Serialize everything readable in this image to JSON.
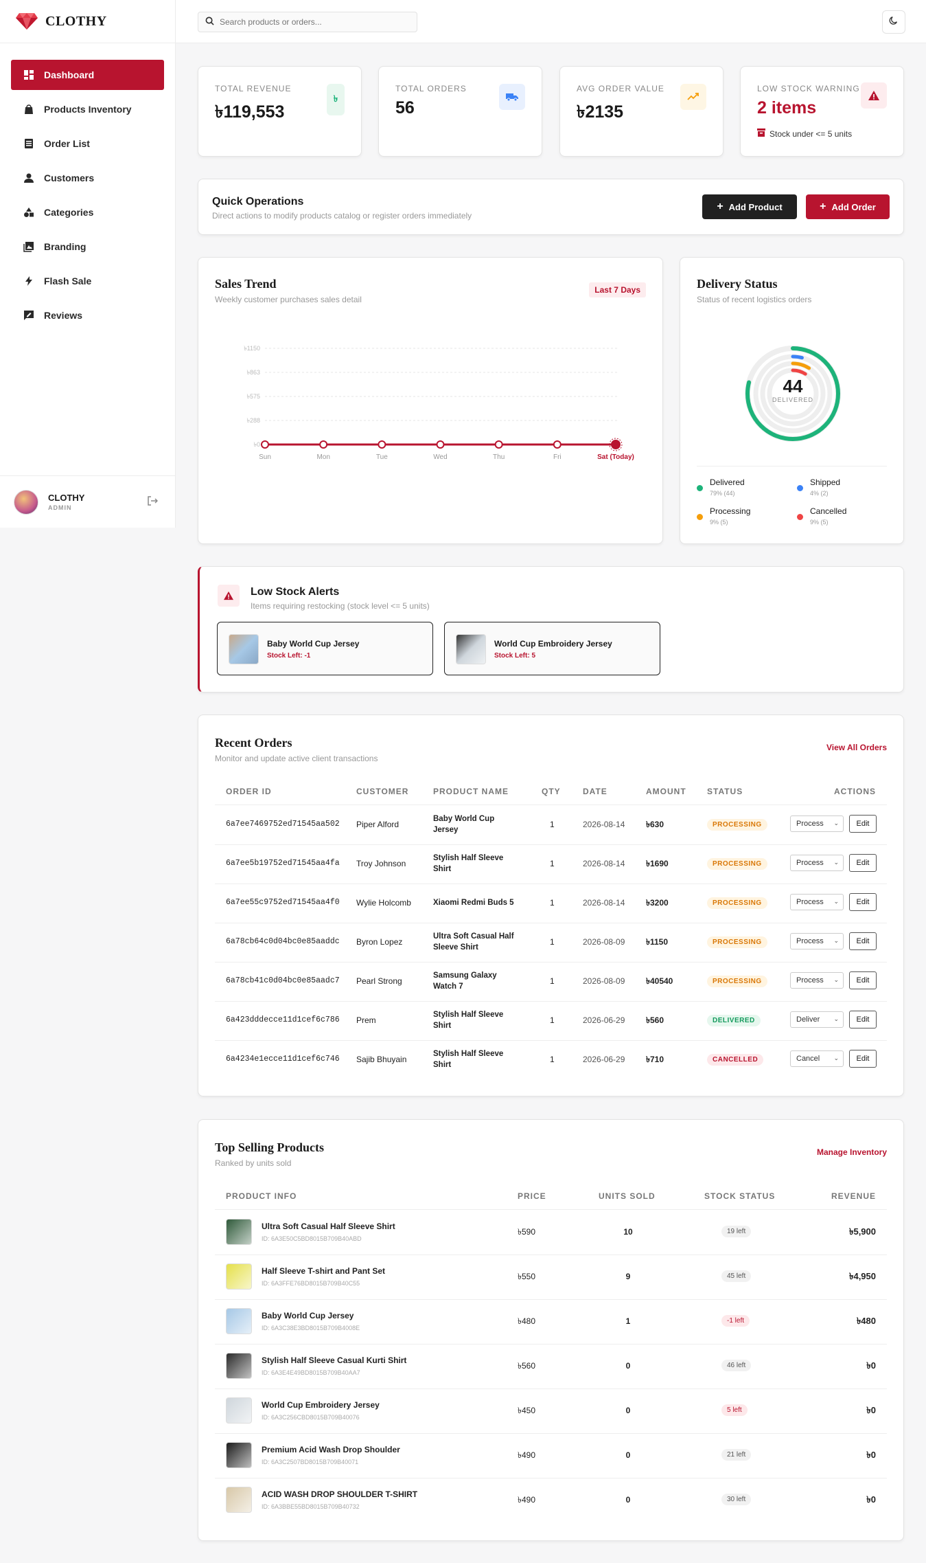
{
  "app": {
    "name": "CLOTHY"
  },
  "sidebar": {
    "items": [
      {
        "label": "Dashboard",
        "icon": "dashboard-icon"
      },
      {
        "label": "Products Inventory",
        "icon": "bag-icon"
      },
      {
        "label": "Order List",
        "icon": "list-icon"
      },
      {
        "label": "Customers",
        "icon": "person-icon"
      },
      {
        "label": "Categories",
        "icon": "categories-icon"
      },
      {
        "label": "Branding",
        "icon": "image-icon"
      },
      {
        "label": "Flash Sale",
        "icon": "bolt-icon"
      },
      {
        "label": "Reviews",
        "icon": "review-icon"
      }
    ],
    "user": {
      "name": "CLOTHY",
      "role": "ADMIN"
    }
  },
  "search": {
    "placeholder": "Search products or orders..."
  },
  "kpis": {
    "revenue": {
      "label": "TOTAL REVENUE",
      "value": "৳119,553",
      "icon": "৳"
    },
    "orders": {
      "label": "TOTAL ORDERS",
      "value": "56"
    },
    "aov": {
      "label": "AVG ORDER VALUE",
      "value": "৳2135"
    },
    "low_stock": {
      "label": "LOW STOCK WARNING",
      "value": "2 items",
      "note": "Stock under <= 5 units"
    }
  },
  "quick_ops": {
    "title": "Quick Operations",
    "subtitle": "Direct actions to modify products catalog or register orders immediately",
    "add_product": "Add Product",
    "add_order": "Add Order"
  },
  "sales_trend": {
    "title": "Sales Trend",
    "subtitle": "Weekly customer purchases sales detail",
    "range": "Last 7 Days"
  },
  "chart_data": {
    "type": "line",
    "categories": [
      "Sun",
      "Mon",
      "Tue",
      "Wed",
      "Thu",
      "Fri",
      "Sat (Today)"
    ],
    "values": [
      0,
      0,
      0,
      0,
      0,
      0,
      0
    ],
    "y_ticks": [
      "৳1150",
      "৳863",
      "৳575",
      "৳288",
      "৳0"
    ],
    "ylim": [
      0,
      1150
    ],
    "grid": true,
    "color": "#b8142f"
  },
  "delivery": {
    "title": "Delivery Status",
    "subtitle": "Status of recent logistics orders",
    "center_value": "44",
    "center_label": "DELIVERED",
    "legend": [
      {
        "name": "Delivered",
        "detail": "79% (44)",
        "color": "#1db37a",
        "fraction": 0.79
      },
      {
        "name": "Shipped",
        "detail": "4% (2)",
        "color": "#3b82f6",
        "fraction": 0.04
      },
      {
        "name": "Processing",
        "detail": "9% (5)",
        "color": "#f59e0b",
        "fraction": 0.09
      },
      {
        "name": "Cancelled",
        "detail": "9% (5)",
        "color": "#ef4444",
        "fraction": 0.09
      }
    ]
  },
  "low_stock": {
    "title": "Low Stock Alerts",
    "subtitle": "Items requiring restocking (stock level <= 5 units)",
    "items": [
      {
        "name": "Baby World Cup Jersey",
        "stock": "Stock Left: -1"
      },
      {
        "name": "World Cup Embroidery Jersey",
        "stock": "Stock Left: 5"
      }
    ]
  },
  "recent_orders": {
    "title": "Recent Orders",
    "subtitle": "Monitor and update active client transactions",
    "view_all": "View All Orders",
    "columns": [
      "ORDER ID",
      "CUSTOMER",
      "PRODUCT NAME",
      "QTY",
      "DATE",
      "AMOUNT",
      "STATUS",
      "ACTIONS"
    ],
    "rows": [
      {
        "id": "6a7ee7469752ed71545aa502",
        "customer": "Piper Alford",
        "product": "Baby World Cup Jersey",
        "qty": "1",
        "date": "2026-08-14",
        "amount": "৳630",
        "status": "PROCESSING",
        "action": "Process",
        "edit": "Edit"
      },
      {
        "id": "6a7ee5b19752ed71545aa4fa",
        "customer": "Troy Johnson",
        "product": "Stylish Half Sleeve Shirt",
        "qty": "1",
        "date": "2026-08-14",
        "amount": "৳1690",
        "status": "PROCESSING",
        "action": "Process",
        "edit": "Edit"
      },
      {
        "id": "6a7ee55c9752ed71545aa4f0",
        "customer": "Wylie Holcomb",
        "product": "Xiaomi Redmi Buds 5",
        "qty": "1",
        "date": "2026-08-14",
        "amount": "৳3200",
        "status": "PROCESSING",
        "action": "Process",
        "edit": "Edit"
      },
      {
        "id": "6a78cb64c0d04bc0e85aaddc",
        "customer": "Byron Lopez",
        "product": "Ultra Soft Casual Half Sleeve Shirt",
        "qty": "1",
        "date": "2026-08-09",
        "amount": "৳1150",
        "status": "PROCESSING",
        "action": "Process",
        "edit": "Edit"
      },
      {
        "id": "6a78cb41c0d04bc0e85aadc7",
        "customer": "Pearl Strong",
        "product": "Samsung Galaxy Watch 7",
        "qty": "1",
        "date": "2026-08-09",
        "amount": "৳40540",
        "status": "PROCESSING",
        "action": "Process",
        "edit": "Edit"
      },
      {
        "id": "6a423dddecce11d1cef6c786",
        "customer": "Prem",
        "product": "Stylish Half Sleeve Shirt",
        "qty": "1",
        "date": "2026-06-29",
        "amount": "৳560",
        "status": "DELIVERED",
        "action": "Deliver",
        "edit": "Edit"
      },
      {
        "id": "6a4234e1ecce11d1cef6c746",
        "customer": "Sajib Bhuyain",
        "product": "Stylish Half Sleeve Shirt",
        "qty": "1",
        "date": "2026-06-29",
        "amount": "৳710",
        "status": "CANCELLED",
        "action": "Cancel",
        "edit": "Edit"
      }
    ]
  },
  "top_products": {
    "title": "Top Selling Products",
    "subtitle": "Ranked by units sold",
    "manage": "Manage Inventory",
    "columns": [
      "PRODUCT INFO",
      "PRICE",
      "UNITS SOLD",
      "STOCK STATUS",
      "REVENUE"
    ],
    "rows": [
      {
        "name": "Ultra Soft Casual Half Sleeve Shirt",
        "id": "ID: 6A3E50C5BD8015B709B40ABD",
        "price": "৳590",
        "units": "10",
        "stock": "19 left",
        "low": false,
        "revenue": "৳5,900",
        "color": "#2f5a3a"
      },
      {
        "name": "Half Sleeve T-shirt and Pant Set",
        "id": "ID: 6A3FFE76BD8015B709B40C55",
        "price": "৳550",
        "units": "9",
        "stock": "45 left",
        "low": false,
        "revenue": "৳4,950",
        "color": "#e5e04a"
      },
      {
        "name": "Baby World Cup Jersey",
        "id": "ID: 6A3C38E3BD8015B709B4008E",
        "price": "৳480",
        "units": "1",
        "stock": "-1 left",
        "low": true,
        "revenue": "৳480",
        "color": "#a6c8e6"
      },
      {
        "name": "Stylish Half Sleeve Casual Kurti Shirt",
        "id": "ID: 6A3E4E49BD8015B709B40AA7",
        "price": "৳560",
        "units": "0",
        "stock": "46 left",
        "low": false,
        "revenue": "৳0",
        "color": "#2b2b2b"
      },
      {
        "name": "World Cup Embroidery Jersey",
        "id": "ID: 6A3C256CBD8015B709B40076",
        "price": "৳450",
        "units": "0",
        "stock": "5 left",
        "low": true,
        "revenue": "৳0",
        "color": "#cfd6dc"
      },
      {
        "name": "Premium Acid Wash Drop Shoulder",
        "id": "ID: 6A3C2507BD8015B709B40071",
        "price": "৳490",
        "units": "0",
        "stock": "21 left",
        "low": false,
        "revenue": "৳0",
        "color": "#1c1c1c"
      },
      {
        "name": "ACID WASH DROP SHOULDER T-SHIRT",
        "id": "ID: 6A3BBE55BD8015B709B40732",
        "price": "৳490",
        "units": "0",
        "stock": "30 left",
        "low": false,
        "revenue": "৳0",
        "color": "#d8c8a8"
      }
    ]
  },
  "colors": {
    "accent": "#b8142f",
    "dark": "#212121"
  }
}
